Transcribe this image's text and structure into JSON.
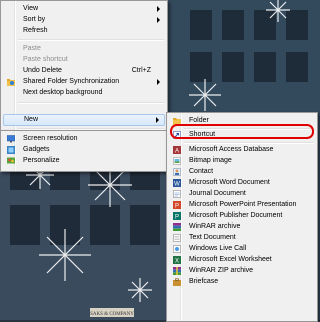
{
  "context_menu": {
    "view": "View",
    "sort_by": "Sort by",
    "refresh": "Refresh",
    "paste": "Paste",
    "paste_shortcut": "Paste shortcut",
    "undo_delete": "Undo Delete",
    "undo_shortcut": "Ctrl+Z",
    "shared_folder_sync": "Shared Folder Synchronization",
    "next_background": "Next desktop background",
    "new": "New",
    "screen_resolution": "Screen resolution",
    "gadgets": "Gadgets",
    "personalize": "Personalize"
  },
  "new_submenu": {
    "items": [
      "Folder",
      "Shortcut",
      "Microsoft Access Database",
      "Bitmap image",
      "Contact",
      "Microsoft Word Document",
      "Journal Document",
      "Microsoft PowerPoint Presentation",
      "Microsoft Publisher Document",
      "WinRAR archive",
      "Text Document",
      "Windows Live Call",
      "Microsoft Excel Worksheet",
      "WinRAR ZIP archive",
      "Briefcase"
    ]
  },
  "wallpaper": {
    "store_sign": "SAKS & COMPANY"
  },
  "colors": {
    "menu_bg": "#f0f0f0",
    "highlight_ring": "#e00000",
    "hover_bg": "#d6e8fb"
  }
}
